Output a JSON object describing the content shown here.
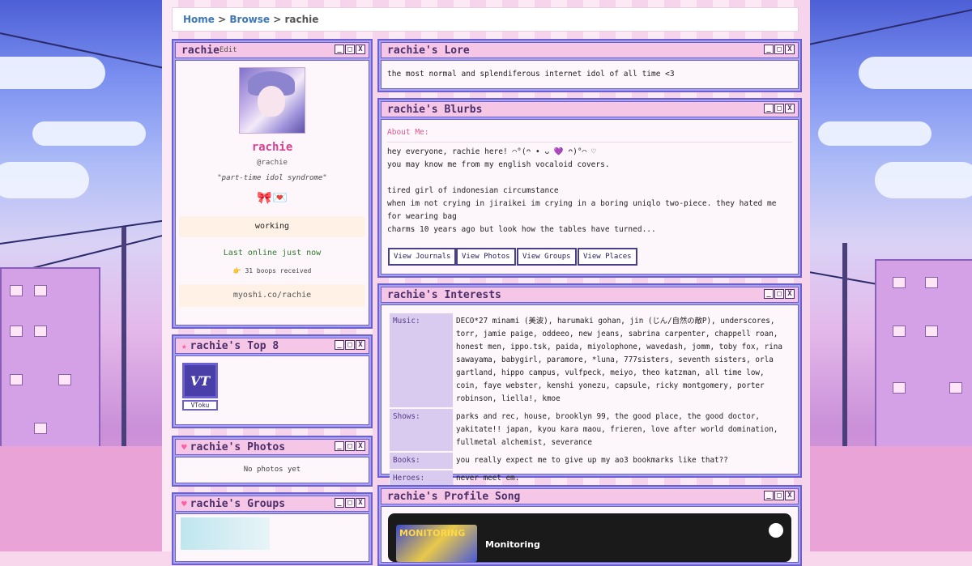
{
  "breadcrumb": {
    "home": "Home",
    "sep1": ">",
    "browse": "Browse",
    "sep2": ">",
    "current": "rachie"
  },
  "profile": {
    "title": "rachie",
    "edit": "Edit",
    "name": "rachie",
    "handle": "@rachie",
    "tagline": "\"part-time idol syndrome\"",
    "emojis": "🎀💌",
    "status": "working",
    "online": "Last online just now",
    "boops": "👉 31 boops received",
    "url": "myoshi.co/rachie"
  },
  "window_buttons": {
    "min": "_",
    "max": "□",
    "close": "X"
  },
  "top8": {
    "title": "rachie's Top 8",
    "items": [
      {
        "label": "VToku",
        "logo": "VT"
      }
    ]
  },
  "photos": {
    "title": "rachie's Photos",
    "empty": "No photos yet"
  },
  "groups": {
    "title": "rachie's Groups"
  },
  "lore": {
    "title": "rachie's Lore",
    "text": "the most normal and splendiferous internet idol of all time <3"
  },
  "blurbs": {
    "title": "rachie's Blurbs",
    "about_label": "About Me:",
    "lines": [
      "hey everyone, rachie here! ⌒°(ᴖ • ᴗ 💜 ᴖ)°⌒ ♡",
      "you may know me from my english vocaloid covers.",
      "",
      "tired girl of indonesian circumstance",
      "when im not crying in jiraikei im crying in a boring uniqlo two-piece. they hated me for wearing bag",
      "charms 10 years ago but look how the tables have turned..."
    ],
    "buttons": [
      "View Journals",
      "View Photos",
      "View Groups",
      "View Places"
    ]
  },
  "interests": {
    "title": "rachie's Interests",
    "rows": [
      {
        "label": "Music:",
        "value": "DECO*27 minami (美波), harumaki gohan, jin (じん/自然の敵P), underscores, torr, jamie paige, oddeeo, new jeans, sabrina carpenter, chappell roan, honest men, ippo.tsk, paida, miyolophone, wavedash, jomm, toby fox, rina sawayama, babygirl, paramore, *luna, 777sisters, seventh sisters, orla gartland, hippo campus, vulfpeck, meiyo, theo katzman, all time low, coin, faye webster, kenshi yonezu, capsule, ricky montgomery, porter robinson, liella!, kmoe"
      },
      {
        "label": "Shows:",
        "value": "parks and rec, house, brooklyn 99, the good place, the good doctor, yakitate!! japan, kyou kara maou, frieren, love after world domination, fullmetal alchemist, severance"
      },
      {
        "label": "Books:",
        "value": "you really expect me to give up my ao3 bookmarks like that??"
      },
      {
        "label": "Heroes:",
        "value": "never meet em."
      }
    ]
  },
  "song": {
    "title": "rachie's Profile Song",
    "track": "Monitoring",
    "cover_text": "MONITORING"
  }
}
